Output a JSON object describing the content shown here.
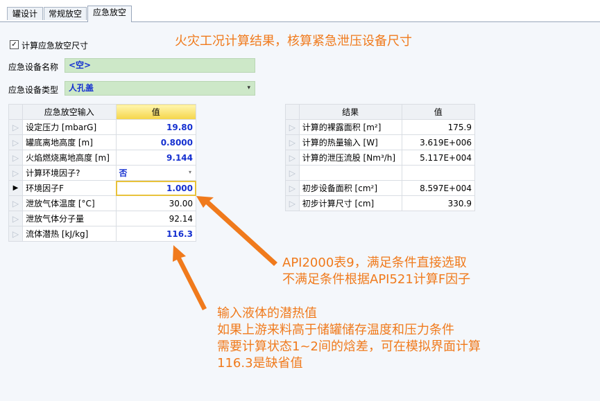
{
  "tabs": [
    "罐设计",
    "常规放空",
    "应急放空"
  ],
  "active_tab": 2,
  "calc_checkbox": {
    "label": "计算应急放空尺寸",
    "checked": true,
    "mark": "✓"
  },
  "fields": {
    "device_name_label": "应急设备名称",
    "device_name_value": "<空>",
    "device_type_label": "应急设备类型",
    "device_type_value": "人孔盖",
    "dropdown_glyph": "▾"
  },
  "input_grid": {
    "headers": [
      "应急放空输入",
      "值"
    ],
    "current_row_marker": "▶",
    "row_marker": "▷",
    "rows": [
      {
        "label": "设定压力 [mbarG]",
        "value": "19.80",
        "style": "blue"
      },
      {
        "label": "罐底离地高度 [m]",
        "value": "0.8000",
        "style": "blue"
      },
      {
        "label": "火焰燃烧离地高度 [m]",
        "value": "9.144",
        "style": "blue"
      },
      {
        "label": "计算环境因子?",
        "value": "否",
        "style": "combo"
      },
      {
        "label": "环境因子F",
        "value": "1.000",
        "style": "blue-selected"
      },
      {
        "label": "泄放气体温度 [°C]",
        "value": "30.00",
        "style": "plain"
      },
      {
        "label": "泄放气体分子量",
        "value": "92.14",
        "style": "plain"
      },
      {
        "label": "流体潜热 [kJ/kg]",
        "value": "116.3",
        "style": "blue"
      }
    ]
  },
  "result_grid": {
    "headers": [
      "结果",
      "值"
    ],
    "rows": [
      {
        "label": "计算的裸露面积 [m²]",
        "value": "175.9"
      },
      {
        "label": "计算的热量输入 [W]",
        "value": "3.619E+006"
      },
      {
        "label": "计算的泄压流股 [Nm³/h]",
        "value": "5.117E+004"
      },
      {
        "label": "",
        "value": ""
      },
      {
        "label": "初步设备面积 [cm²]",
        "value": "8.597E+004"
      },
      {
        "label": "初步计算尺寸 [cm]",
        "value": "330.9"
      }
    ]
  },
  "annotations": {
    "title": "火灾工况计算结果，核算紧急泄压设备尺寸",
    "note_env": [
      "API2000表9，满足条件直接选取",
      "不满足条件根据API521计算F因子"
    ],
    "note_latent": [
      "输入液体的潜热值",
      "如果上游来料高于储罐储存温度和压力条件",
      "需要计算状态1~2间的焓差，可在模拟界面计算",
      "116.3是缺省值"
    ]
  },
  "colors": {
    "annotation": "#f07a1c",
    "value_blue": "#1530d0",
    "field_green": "#cde8c8"
  }
}
